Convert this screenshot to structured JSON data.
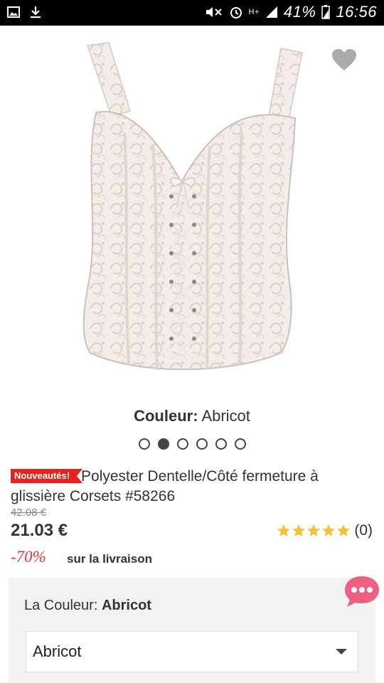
{
  "status_bar": {
    "battery": "41%",
    "time": "16:56",
    "network": "H+"
  },
  "product": {
    "color_caption_label": "Couleur:",
    "color_caption_value": "Abricot",
    "badge": "Nouveautés!",
    "title": "Polyester Dentelle/Côté fermeture à glissière Corsets #58266",
    "old_price": "42.08 €",
    "price": "21.03 €",
    "rating_count": "(0)",
    "rating_value": 5,
    "discount": "-70%",
    "shipping": "sur la livraison",
    "gallery_count": 6,
    "gallery_active_index": 1
  },
  "options": {
    "color_label": "La Couleur:",
    "color_value": "Abricot",
    "color_select_value": "Abricot"
  },
  "colors": {
    "badge": "#e8231f",
    "discount": "#e03a3a",
    "star": "#f5c230",
    "chat": "#ef5f82"
  },
  "icons": [
    "image-icon",
    "download-icon",
    "mute-icon",
    "alarm-icon",
    "signal-icon",
    "battery-icon",
    "heart-icon",
    "star-icon",
    "chevron-down-icon",
    "chat-icon"
  ]
}
